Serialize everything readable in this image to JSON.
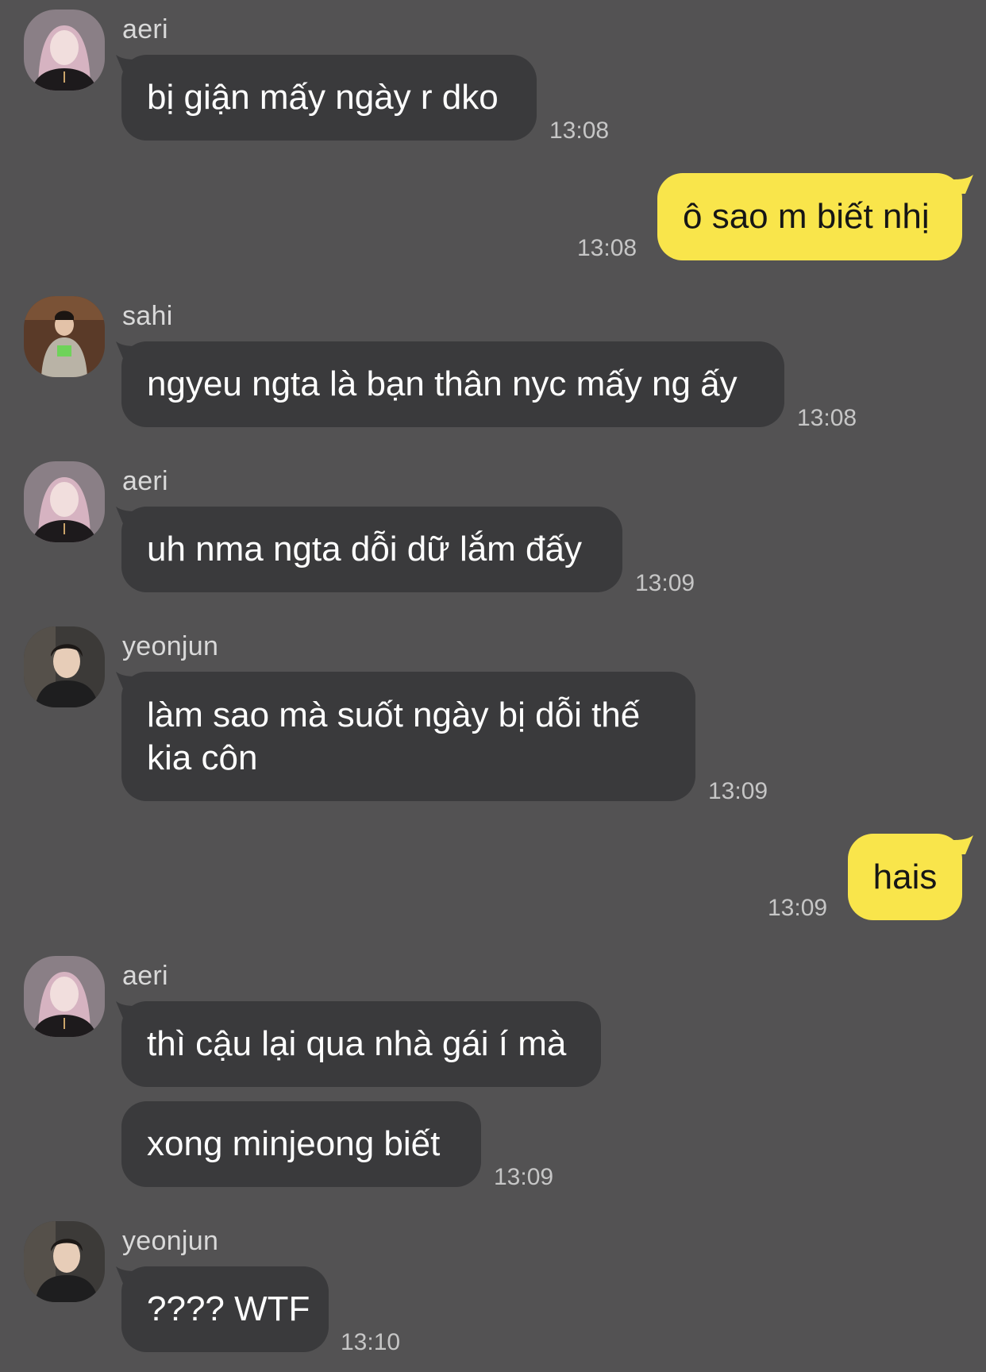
{
  "colors": {
    "background": "#535253",
    "incoming_bubble": "#3a3a3c",
    "outgoing_bubble": "#f9e54b",
    "sender_text": "#d9d9d9",
    "time_text": "#c6c6c6"
  },
  "messages": [
    {
      "sender": "aeri",
      "text": "bị giận mấy ngày r dko",
      "time": "13:08"
    },
    {
      "sender": "me",
      "text": "ô sao m biết nhị",
      "time": "13:08"
    },
    {
      "sender": "sahi",
      "text": "ngyeu ngta là bạn thân nyc mấy ng ấy",
      "time": "13:08"
    },
    {
      "sender": "aeri",
      "text": "uh nma ngta dỗi dữ lắm đấy",
      "time": "13:09"
    },
    {
      "sender": "yeonjun",
      "text": "làm sao mà suốt ngày bị dỗi thế kia côn",
      "time": "13:09"
    },
    {
      "sender": "me",
      "text": "hais",
      "time": "13:09"
    },
    {
      "sender": "aeri",
      "texts": [
        "thì cậu lại qua nhà gái í mà",
        "xong minjeong biết"
      ],
      "time": "13:09"
    },
    {
      "sender": "yeonjun",
      "text": "???? WTF",
      "time": "13:10"
    }
  ]
}
